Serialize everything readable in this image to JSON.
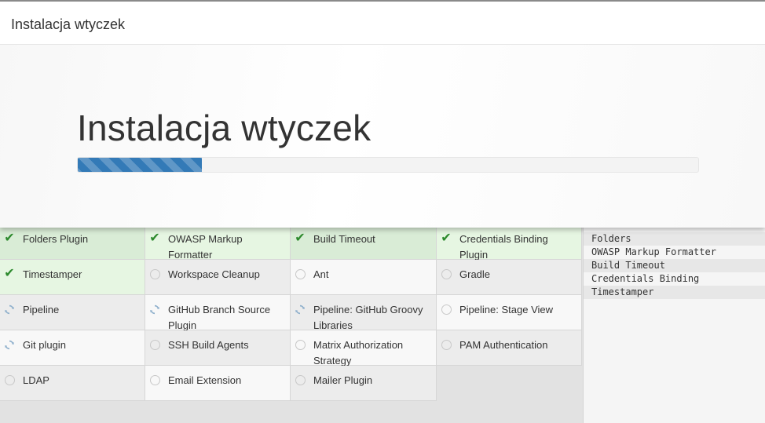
{
  "dialog": {
    "header_title": "Instalacja wtyczek",
    "hero_title": "Instalacja wtyczek",
    "progress_fraction": 0.2
  },
  "plugins": [
    {
      "name": "Folders Plugin",
      "status": "success"
    },
    {
      "name": "OWASP Markup Formatter",
      "status": "success"
    },
    {
      "name": "Build Timeout",
      "status": "success"
    },
    {
      "name": "Credentials Binding Plugin",
      "status": "success"
    },
    {
      "name": "Timestamper",
      "status": "success"
    },
    {
      "name": "Workspace Cleanup",
      "status": "pending"
    },
    {
      "name": "Ant",
      "status": "pending"
    },
    {
      "name": "Gradle",
      "status": "pending"
    },
    {
      "name": "Pipeline",
      "status": "installing"
    },
    {
      "name": "GitHub Branch Source Plugin",
      "status": "installing"
    },
    {
      "name": "Pipeline: GitHub Groovy Libraries",
      "status": "installing"
    },
    {
      "name": "Pipeline: Stage View",
      "status": "pending"
    },
    {
      "name": "Git plugin",
      "status": "installing"
    },
    {
      "name": "SSH Build Agents",
      "status": "pending"
    },
    {
      "name": "Matrix Authorization Strategy",
      "status": "pending"
    },
    {
      "name": "PAM Authentication",
      "status": "pending"
    },
    {
      "name": "LDAP",
      "status": "pending"
    },
    {
      "name": "Email Extension",
      "status": "pending"
    },
    {
      "name": "Mailer Plugin",
      "status": "pending"
    }
  ],
  "status_icons": {
    "success": "check-icon",
    "installing": "refresh-icon",
    "pending": "circle-icon"
  },
  "install_log": [
    "Folders",
    "OWASP Markup Formatter",
    "Build Timeout",
    "Credentials Binding",
    "Timestamper"
  ],
  "colors": {
    "progress": "#337ab7",
    "success": "#2d8a2d",
    "installing": "#8fb0cc"
  }
}
